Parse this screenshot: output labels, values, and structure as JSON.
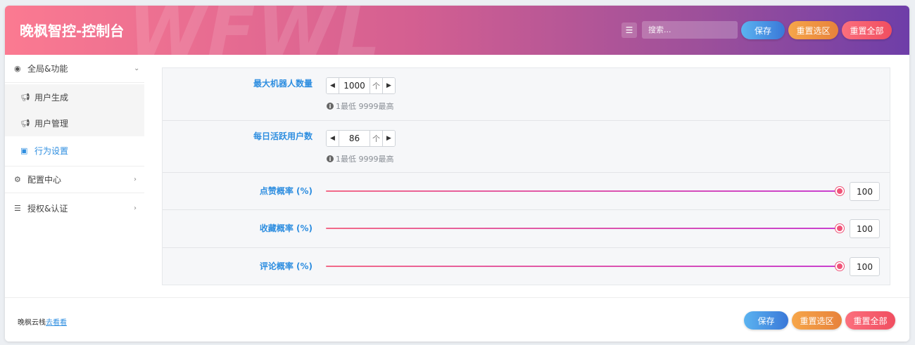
{
  "header": {
    "title": "晚枫智控-控制台",
    "watermark": "WFWL",
    "search_placeholder": "搜索...",
    "save_label": "保存",
    "reset_selection_label": "重置选区",
    "reset_all_label": "重置全部"
  },
  "sidebar": {
    "items": [
      {
        "label": "全局&功能",
        "icon": "circle-dot-icon",
        "chevron": "⌄"
      },
      {
        "label": "用户生成",
        "icon": "megaphone-icon"
      },
      {
        "label": "用户管理",
        "icon": "megaphone-icon"
      },
      {
        "label": "行为设置",
        "icon": "image-icon"
      },
      {
        "label": "配置中心",
        "icon": "gear-icon",
        "chevron": "›"
      },
      {
        "label": "授权&认证",
        "icon": "stack-icon",
        "chevron": "›"
      }
    ]
  },
  "settings": {
    "max_robots": {
      "label": "最大机器人数量",
      "value": "1000",
      "hint": "1最低 9999最高"
    },
    "daily_active": {
      "label": "每日活跃用户数",
      "value": "86",
      "hint": "1最低 9999最高"
    },
    "like_rate": {
      "label": "点赞概率 (%)",
      "value": "100",
      "fraction": 1.0
    },
    "favorite_rate": {
      "label": "收藏概率 (%)",
      "value": "100",
      "fraction": 1.0
    },
    "comment_rate": {
      "label": "评论概率 (%)",
      "value": "100",
      "fraction": 1.0
    }
  },
  "footer": {
    "brand_text": "晚枫云栈",
    "brand_link": "去看看",
    "save_label": "保存",
    "reset_selection_label": "重置选区",
    "reset_all_label": "重置全部"
  },
  "colors": {
    "accent_blue": "#2e8ee0",
    "header_start": "#fb7a91",
    "header_end": "#6e3ea8",
    "slider_thumb": "#f05378"
  }
}
